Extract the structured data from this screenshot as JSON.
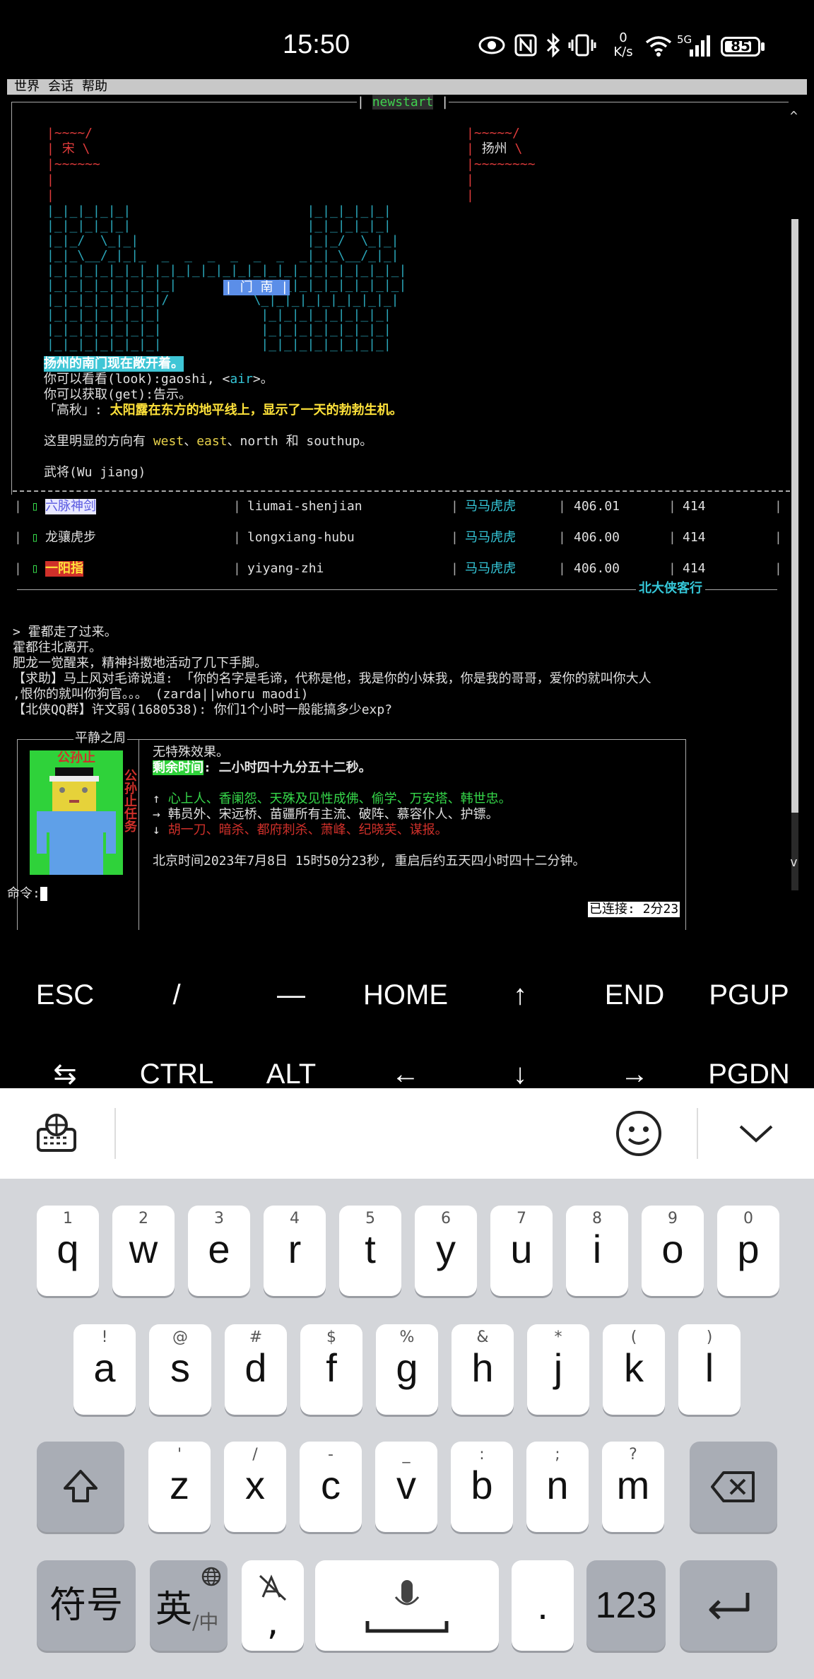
{
  "status_bar": {
    "time": "15:50",
    "net_speed_value": "0",
    "net_speed_unit": "K/s",
    "signal_label": "5G",
    "battery": "85",
    "battery_level": 0.85
  },
  "menu": [
    "世界",
    "会话",
    "帮助"
  ],
  "room": {
    "frame_title": "newstart",
    "sign_left": "宋",
    "sign_right": "扬州",
    "gate_label": "门 南",
    "desc_highlight": "扬州的南门现在敞开着。",
    "look_prefix": "你可以看看(look):gaoshi, <",
    "look_obj": "air",
    "look_suffix": ">。",
    "get_line": "你可以获取(get):告示。",
    "season_prefix": "「高秋」: ",
    "season_text": "太阳露在东方的地平线上，显示了一天的勃勃生机。",
    "exits_prefix": "这里明显的方向有 ",
    "exit_west": "west",
    "exit_sep": "、",
    "exit_east": "east",
    "exit_rest": "、north 和 southup。",
    "npc": "武将(Wu jiang)"
  },
  "skills_table": {
    "footer": "北大侠客行",
    "rows": [
      {
        "name": "六脉神剑",
        "id": "liumai-shenjian",
        "level": "马马虎虎",
        "value": "406.01",
        "num": "414"
      },
      {
        "name": "龙骧虎步",
        "id": "longxiang-hubu",
        "level": "马马虎虎",
        "value": "406.00",
        "num": "414"
      },
      {
        "name": "一阳指",
        "id": "yiyang-zhi",
        "level": "马马虎虎",
        "value": "406.00",
        "num": "414"
      }
    ]
  },
  "messages": [
    "> 霍都走了过来。",
    "霍都往北离开。",
    "肥龙一觉醒来，精神抖擞地活动了几下手脚。",
    "【求助】马上风对毛谛说道: 「你的名字是毛谛，代称是他，我是你的小妹我，你是我的哥哥，爱你的就叫你大人",
    ",恨你的就叫你狗官。。。 (zarda||whoru maodi)",
    "【北侠QQ群】许文弱(1680538): 你们1个小时一般能搞多少exp?"
  ],
  "status_panel": {
    "title": "平静之周",
    "char_name": "公孙止",
    "task_label": "公孙止任务",
    "effect": "无特殊效果。",
    "remain_label": "剩余时间",
    "remain_value": ": 二小时四十九分五十二秒。",
    "up_arrow": "↑",
    "up_list": "心上人、香阑怨、天殊及见性成佛、偷学、万安塔、韩世忠。",
    "right_arrow": "→",
    "right_list": "韩员外、宋远桥、苗疆所有主流、破阵、慕容仆人、护镖。",
    "down_arrow": "↓",
    "down_list": "胡一刀、暗杀、都府刺杀、萧峰、纪晓芙、谋报。",
    "beijing_time": "北京时间2023年7月8日 15时50分23秒, 重启后约五天四小时四十二分钟。"
  },
  "command": {
    "prompt": "命令:",
    "connected": "已连接: 2分23"
  },
  "extra_keys": {
    "row1": [
      "ESC",
      "/",
      "—",
      "HOME",
      "↑",
      "END",
      "PGUP"
    ],
    "row2": [
      "⇆",
      "CTRL",
      "ALT",
      "←",
      "↓",
      "→",
      "PGDN"
    ]
  },
  "keyboard": {
    "row1": [
      {
        "hint": "1",
        "key": "q"
      },
      {
        "hint": "2",
        "key": "w"
      },
      {
        "hint": "3",
        "key": "e"
      },
      {
        "hint": "4",
        "key": "r"
      },
      {
        "hint": "5",
        "key": "t"
      },
      {
        "hint": "6",
        "key": "y"
      },
      {
        "hint": "7",
        "key": "u"
      },
      {
        "hint": "8",
        "key": "i"
      },
      {
        "hint": "9",
        "key": "o"
      },
      {
        "hint": "0",
        "key": "p"
      }
    ],
    "row2": [
      {
        "hint": "!",
        "key": "a"
      },
      {
        "hint": "@",
        "key": "s"
      },
      {
        "hint": "#",
        "key": "d"
      },
      {
        "hint": "$",
        "key": "f"
      },
      {
        "hint": "%",
        "key": "g"
      },
      {
        "hint": "&",
        "key": "h"
      },
      {
        "hint": "*",
        "key": "j"
      },
      {
        "hint": "(",
        "key": "k"
      },
      {
        "hint": ")",
        "key": "l"
      }
    ],
    "row3": [
      {
        "hint": "'",
        "key": "z"
      },
      {
        "hint": "/",
        "key": "x"
      },
      {
        "hint": "-",
        "key": "c"
      },
      {
        "hint": "_",
        "key": "v"
      },
      {
        "hint": ":",
        "key": "b"
      },
      {
        "hint": ";",
        "key": "n"
      },
      {
        "hint": "?",
        "key": "m"
      }
    ],
    "symbols": "符号",
    "lang": "英",
    "lang_sub": "/中",
    "punct": ",",
    "period": ".",
    "numbers": "123"
  }
}
